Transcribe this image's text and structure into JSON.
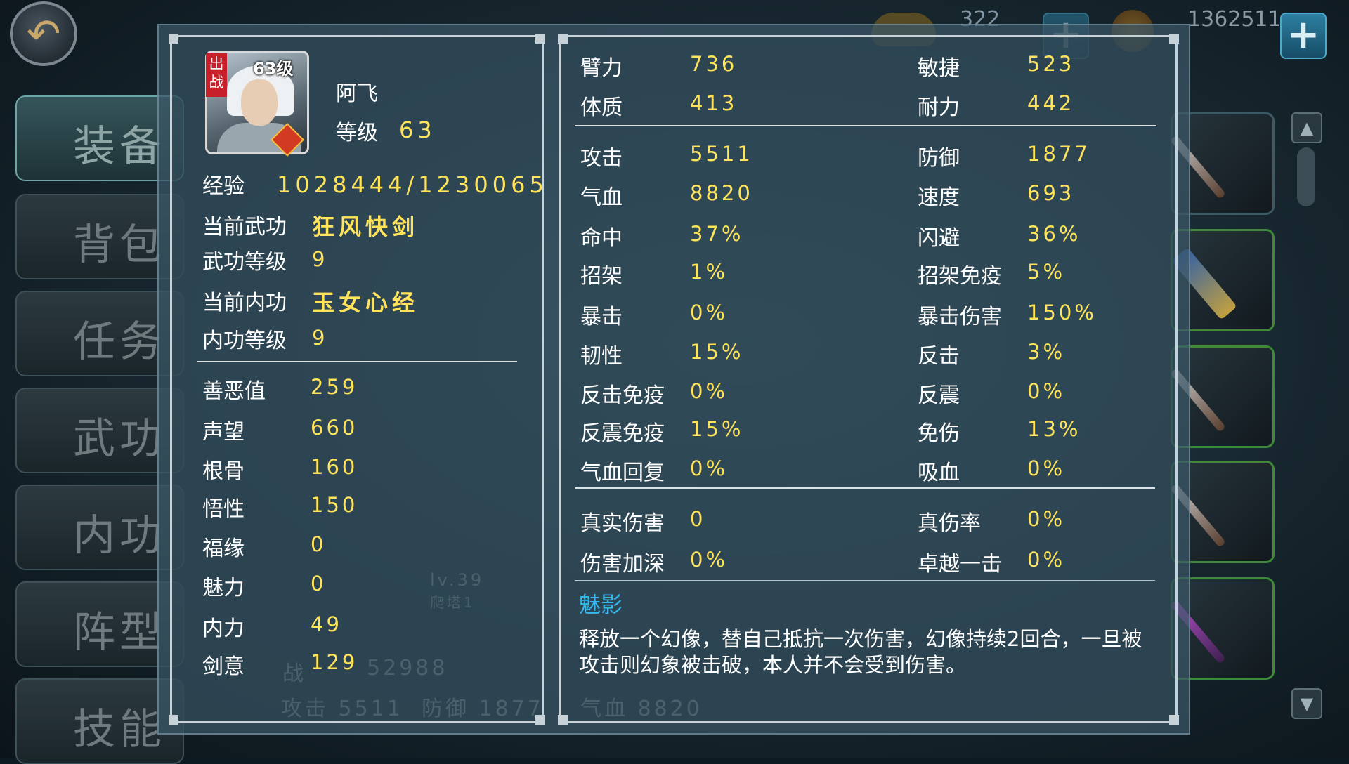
{
  "topbar": {
    "resource_1_value": "322",
    "resource_2_value": "1362511",
    "back_icon": "back-arrow-icon",
    "plus_icon": "plus-icon"
  },
  "nav": {
    "items": [
      {
        "label": "装备"
      },
      {
        "label": "背包"
      },
      {
        "label": "任务"
      },
      {
        "label": "武功"
      },
      {
        "label": "内功"
      },
      {
        "label": "阵型"
      },
      {
        "label": "技能"
      }
    ]
  },
  "character": {
    "name": "阿飞",
    "avatar_level": "63级",
    "deploy_tag": "出战",
    "level_label": "等级",
    "level_value": "63",
    "exp_label": "经验",
    "exp_value": "1028444/1230065",
    "martial_label": "当前武功",
    "martial_value": "狂风快剑",
    "martial_level_label": "武功等级",
    "martial_level_value": "9",
    "inner_label": "当前内功",
    "inner_value": "玉女心经",
    "inner_level_label": "内功等级",
    "inner_level_value": "9"
  },
  "attributes": [
    {
      "label": "善恶值",
      "value": "259"
    },
    {
      "label": "声望",
      "value": "660"
    },
    {
      "label": "根骨",
      "value": "160"
    },
    {
      "label": "悟性",
      "value": "150"
    },
    {
      "label": "福缘",
      "value": "0"
    },
    {
      "label": "魅力",
      "value": "0"
    },
    {
      "label": "内力",
      "value": "49"
    },
    {
      "label": "剑意",
      "value": "129"
    }
  ],
  "stats_base": [
    {
      "label": "臂力",
      "value": "736"
    },
    {
      "label": "敏捷",
      "value": "523"
    },
    {
      "label": "体质",
      "value": "413"
    },
    {
      "label": "耐力",
      "value": "442"
    }
  ],
  "stats_combat": [
    {
      "label": "攻击",
      "value": "5511"
    },
    {
      "label": "防御",
      "value": "1877"
    },
    {
      "label": "气血",
      "value": "8820"
    },
    {
      "label": "速度",
      "value": "693"
    },
    {
      "label": "命中",
      "value": "37%"
    },
    {
      "label": "闪避",
      "value": "36%"
    },
    {
      "label": "招架",
      "value": "1%"
    },
    {
      "label": "招架免疫",
      "value": "5%"
    },
    {
      "label": "暴击",
      "value": "0%"
    },
    {
      "label": "暴击伤害",
      "value": "150%"
    },
    {
      "label": "韧性",
      "value": "15%"
    },
    {
      "label": "反击",
      "value": "3%"
    },
    {
      "label": "反击免疫",
      "value": "0%"
    },
    {
      "label": "反震",
      "value": "0%"
    },
    {
      "label": "反震免疫",
      "value": "15%"
    },
    {
      "label": "免伤",
      "value": "13%"
    },
    {
      "label": "气血回复",
      "value": "0%"
    },
    {
      "label": "吸血",
      "value": "0%"
    }
  ],
  "stats_special": [
    {
      "label": "真实伤害",
      "value": "0"
    },
    {
      "label": "真伤率",
      "value": "0%"
    },
    {
      "label": "伤害加深",
      "value": "0%"
    },
    {
      "label": "卓越一击",
      "value": "0%"
    }
  ],
  "skill": {
    "name": "魅影",
    "description": "释放一个幻像，替自己抵抗一次伤害，幻像持续2回合，一旦被攻击则幻象被击破，本人并不会受到伤害。"
  },
  "background_text": {
    "power_label": "战",
    "power_value": "52988",
    "atk": "攻击 5511",
    "def": "防御 1877",
    "hp": "气血 8820",
    "pet_level": "lv.39",
    "pet_name": "爬塔1"
  },
  "colors": {
    "value_yellow": "#ffe35a",
    "skill_blue": "#35b8f0",
    "panel_border": "#c7d2d8"
  }
}
